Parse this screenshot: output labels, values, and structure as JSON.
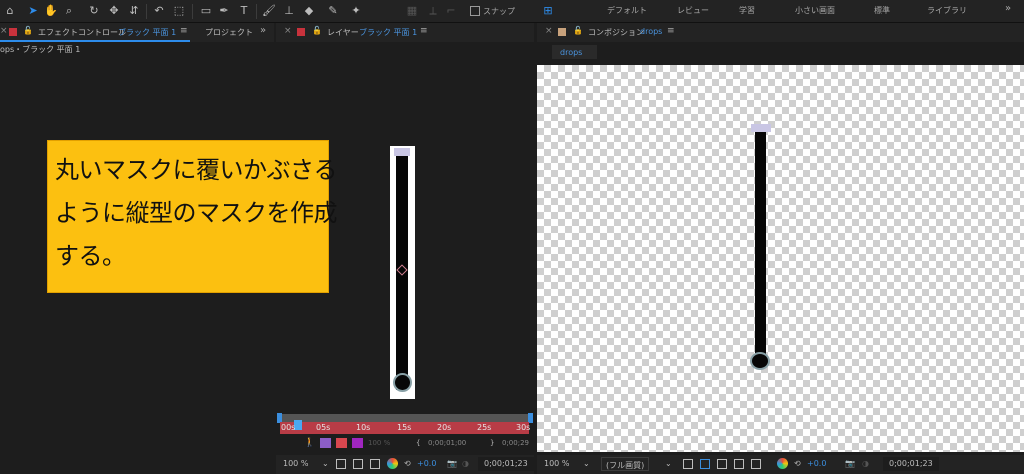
{
  "toolbar": {
    "snap_label": "スナップ",
    "workspaces": [
      "デフォルト",
      "レビュー",
      "学習",
      "小さい画面",
      "標準",
      "ライブラリ"
    ],
    "more": "»",
    "icons": [
      "home-icon",
      "selection-tool-icon",
      "hand-tool-icon",
      "zoom-tool-icon",
      "rotate-tool-icon",
      "anchor-tool-icon",
      "pan-behind-tool-icon",
      "rectangle-tool-icon",
      "pen-tool-icon",
      "text-tool-icon",
      "brush-tool-icon",
      "clone-stamp-tool-icon",
      "eraser-tool-icon",
      "roto-brush-tool-icon",
      "puppet-tool-icon"
    ]
  },
  "effects_panel": {
    "close": "×",
    "tab_label": "エフェクトコントロール",
    "layer_name": "ブラック 平面 1",
    "menu": "≡",
    "project_tab": "プロジェクト",
    "more": "»",
    "breadcrumb": "ops・ブラック 平面 1"
  },
  "layer_panel": {
    "close": "×",
    "tab_label": "レイヤー",
    "layer_name": "ブラック 平面 1",
    "menu": "≡",
    "timeline_labels": [
      "00s",
      "05s",
      "10s",
      "15s",
      "20s",
      "25s",
      "30s"
    ],
    "in_time": "0;00;01;00",
    "out_time": "0;00;29",
    "opacity": "100 %",
    "zoom": "100 %",
    "exposure": "+0.0",
    "current_time": "0;00;01;23"
  },
  "comp_panel": {
    "close": "×",
    "tab_label": "コンポジション",
    "comp_name": "drops",
    "menu": "≡",
    "sub_tab": "drops",
    "zoom": "100 %",
    "resolution": "(フル画質)",
    "exposure": "+0.0",
    "current_time": "0;00;01;23"
  },
  "annotation": {
    "lines": [
      "丸いマスクに覆いかぶさる",
      "ように縦型のマスクを作成",
      "する。"
    ]
  },
  "colors": {
    "accent": "#2d8ceb",
    "label_red": "#c8323c",
    "comp_label": "#c8a27c",
    "callout_bg": "#fcc010",
    "timeline_bar": "#b83c46"
  }
}
